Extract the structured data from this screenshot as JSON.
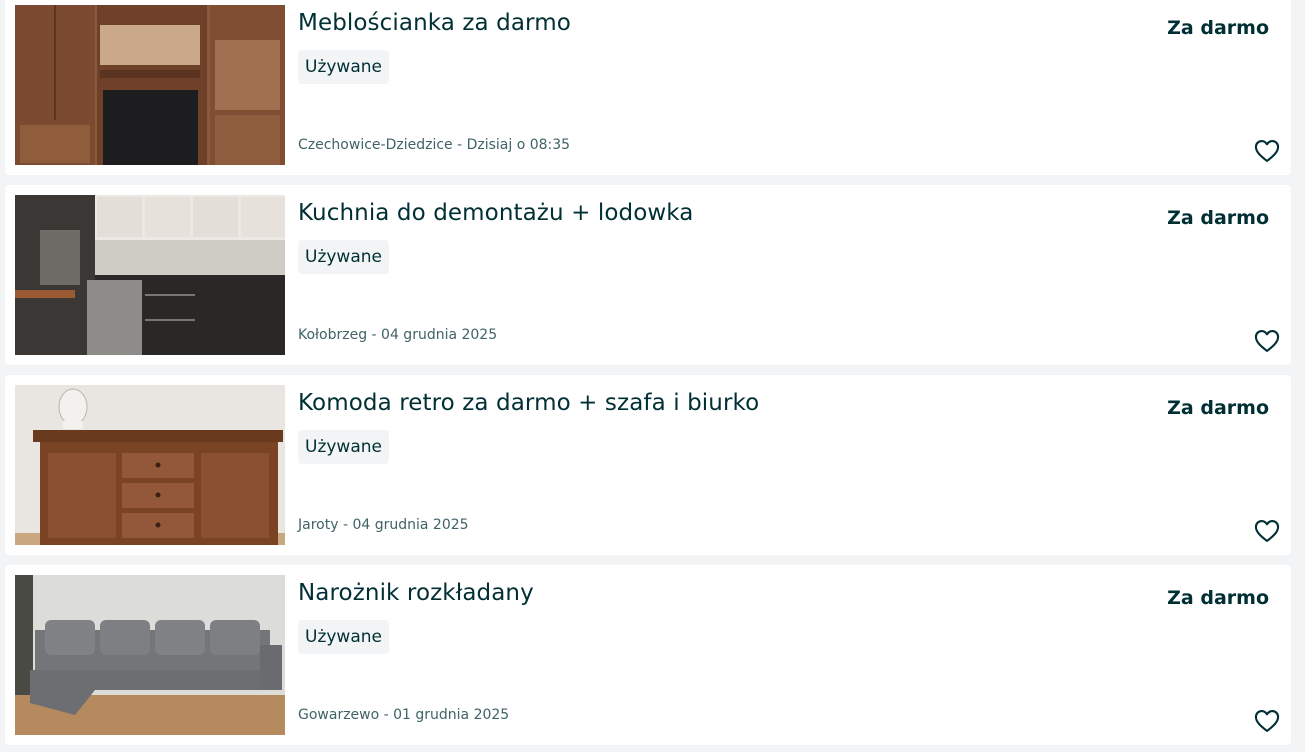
{
  "listings": [
    {
      "title": "Meblościanka za darmo",
      "condition": "Używane",
      "location_date": "Czechowice-Dziedzice - Dzisiaj o 08:35",
      "price": "Za darmo",
      "image_desc": "wall-unit-furniture"
    },
    {
      "title": "Kuchnia do demontażu + lodowka",
      "condition": "Używane",
      "location_date": "Kołobrzeg - 04 grudnia 2025",
      "price": "Za darmo",
      "image_desc": "kitchen-cabinets"
    },
    {
      "title": "Komoda retro za darmo + szafa i biurko",
      "condition": "Używane",
      "location_date": "Jaroty - 04 grudnia 2025",
      "price": "Za darmo",
      "image_desc": "wooden-dresser"
    },
    {
      "title": "Narożnik rozkładany",
      "condition": "Używane",
      "location_date": "Gowarzewo - 01 grudnia 2025",
      "price": "Za darmo",
      "image_desc": "grey-corner-sofa"
    }
  ],
  "icons": {
    "favorite": "heart-outline-icon"
  },
  "colors": {
    "text": "#002f34",
    "meta": "#406367",
    "badge_bg": "#f2f4f5",
    "page_bg": "#f2f4f5"
  }
}
